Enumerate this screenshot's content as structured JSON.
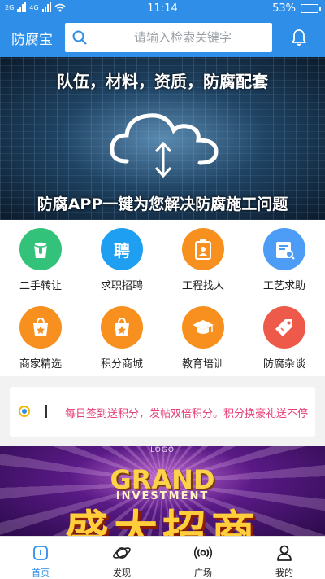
{
  "status_bar": {
    "network_1": "2G",
    "network_2": "4G",
    "time": "11:14",
    "battery": "53%",
    "battery_level": 0.53
  },
  "header": {
    "app_title": "防腐宝",
    "search_placeholder": "请输入检索关键字"
  },
  "banner": {
    "headline": "队伍，材料，资质，防腐配套",
    "tagline": "防腐APP一键为您解决防腐施工问题"
  },
  "grid_items": [
    {
      "label": "二手转让",
      "icon": "paint-bucket-icon",
      "color": "#33c27a"
    },
    {
      "label": "求职招聘",
      "icon": "recruit-icon",
      "color": "#1e9ff2"
    },
    {
      "label": "工程找人",
      "icon": "clipboard-person-icon",
      "color": "#f7901e"
    },
    {
      "label": "工艺求助",
      "icon": "document-search-icon",
      "color": "#4d9cf5"
    },
    {
      "label": "商家精选",
      "icon": "shopping-bag-star-icon",
      "color": "#f7901e"
    },
    {
      "label": "积分商城",
      "icon": "points-bag-star-icon",
      "color": "#f7901e"
    },
    {
      "label": "教育培训",
      "icon": "graduation-cap-icon",
      "color": "#f7901e"
    },
    {
      "label": "防腐杂谈",
      "icon": "tag-icon",
      "color": "#ee5a4a"
    }
  ],
  "notice": {
    "text": "每日签到送积分，发帖双倍积分。积分换豪礼送不停",
    "color": "#e53e78"
  },
  "promo": {
    "logo_text": "LOGO",
    "grand": "GRAND",
    "investment": "INVESTMENT",
    "big_text": "盛大招商"
  },
  "tabbar": {
    "items": [
      {
        "label": "首页",
        "icon": "home-icon",
        "active": true
      },
      {
        "label": "发现",
        "icon": "planet-icon",
        "active": false
      },
      {
        "label": "广场",
        "icon": "broadcast-icon",
        "active": false
      },
      {
        "label": "我的",
        "icon": "user-icon",
        "active": false
      }
    ]
  },
  "colors": {
    "primary": "#2e8ee8",
    "active_tab": "#2e8ee8"
  }
}
